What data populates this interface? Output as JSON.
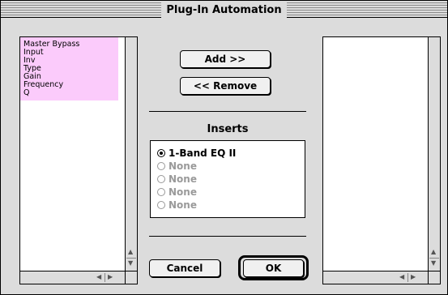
{
  "window": {
    "title": "Plug-In Automation"
  },
  "left_list": {
    "items": [
      "Master Bypass",
      "Input",
      "Inv",
      "Type",
      "Gain",
      "Frequency",
      "Q"
    ]
  },
  "buttons": {
    "add": "Add >>",
    "remove": "<< Remove",
    "cancel": "Cancel",
    "ok": "OK"
  },
  "inserts": {
    "label": "Inserts",
    "options": [
      {
        "label": "1-Band EQ II",
        "selected": true
      },
      {
        "label": "None",
        "selected": false
      },
      {
        "label": "None",
        "selected": false
      },
      {
        "label": "None",
        "selected": false
      },
      {
        "label": "None",
        "selected": false
      }
    ]
  },
  "colors": {
    "selection": "#fbcbfb",
    "dialog_bg": "#dcdcdc",
    "disabled_text": "#9a9a9a"
  },
  "icons": {
    "scroll_up": "▲",
    "scroll_down": "▼",
    "scroll_left": "◀",
    "scroll_right": "▶"
  }
}
